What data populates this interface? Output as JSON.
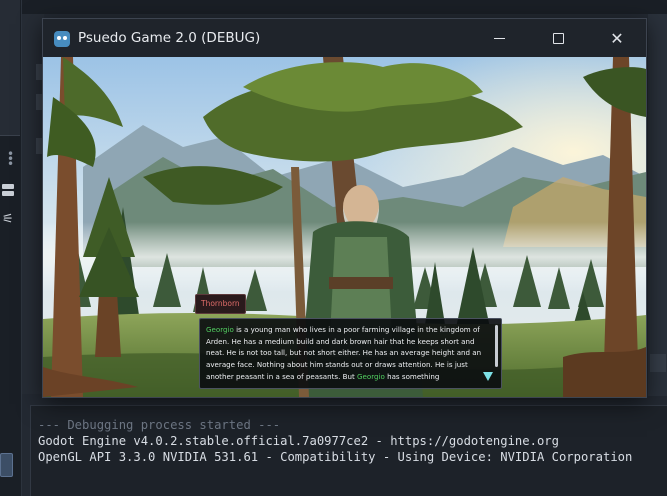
{
  "window": {
    "title": "Psuedo Game 2.0 (DEBUG)",
    "minimize_icon": "minimize-icon",
    "maximize_icon": "maximize-icon",
    "close_icon": "close-icon"
  },
  "dialogue": {
    "speaker": "Thornborn",
    "name_highlight": "Georgio",
    "seg1": " is a young man who lives in a poor farming village in the kingdom of Arden. He has a medium build and dark brown hair that he keeps short and neat. He is not too tall, but not short either. He has an average height and an average face. Nothing about him stands out or draws attention. He is just another peasant in a sea of peasants. But ",
    "seg2": " has something",
    "advance_icon": "triangle-down-icon"
  },
  "output": {
    "lines": [
      "--- Debugging process started ---",
      "Godot Engine v4.0.2.stable.official.7a0977ce2 - https://godotengine.org",
      "OpenGL API 3.3.0 NVIDIA 531.61 - Compatibility - Using Device: NVIDIA Corporation"
    ]
  },
  "colors": {
    "highlight": "#52d061",
    "speaker": "#e06d6a",
    "advance_arrow": "#7de1e6"
  }
}
